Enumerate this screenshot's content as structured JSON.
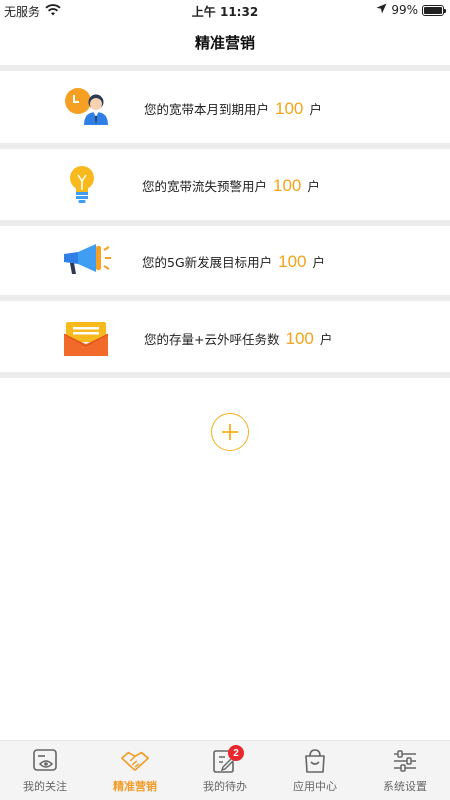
{
  "status_bar": {
    "carrier": "无服务",
    "time": "上午 11:32",
    "battery_percent": "99%",
    "battery_level": 0.99
  },
  "nav": {
    "title": "精准营销"
  },
  "cards": [
    {
      "prefix": "您的宽带本月到期用户",
      "count": "100",
      "unit": "户",
      "icon": "user-clock-icon"
    },
    {
      "prefix": "您的宽带流失预警用户",
      "count": "100",
      "unit": "户",
      "icon": "lightbulb-icon"
    },
    {
      "prefix": "您的5G新发展目标用户",
      "count": "100",
      "unit": "户",
      "icon": "megaphone-icon"
    },
    {
      "prefix": "您的存量+云外呼任务数",
      "count": "100",
      "unit": "户",
      "icon": "envelope-icon"
    }
  ],
  "add_icon": "plus-circle-icon",
  "tabs": [
    {
      "label": "我的关注",
      "icon": "eye-card-icon",
      "active": false
    },
    {
      "label": "精准营销",
      "icon": "handshake-icon",
      "active": true
    },
    {
      "label": "我的待办",
      "icon": "edit-note-icon",
      "active": false,
      "badge": "2"
    },
    {
      "label": "应用中心",
      "icon": "bag-icon",
      "active": false
    },
    {
      "label": "系统设置",
      "icon": "sliders-icon",
      "active": false
    }
  ],
  "colors": {
    "accent": "#f29d2a",
    "count": "#f5a31a",
    "badge": "#e8272f",
    "divider": "#ececec"
  }
}
